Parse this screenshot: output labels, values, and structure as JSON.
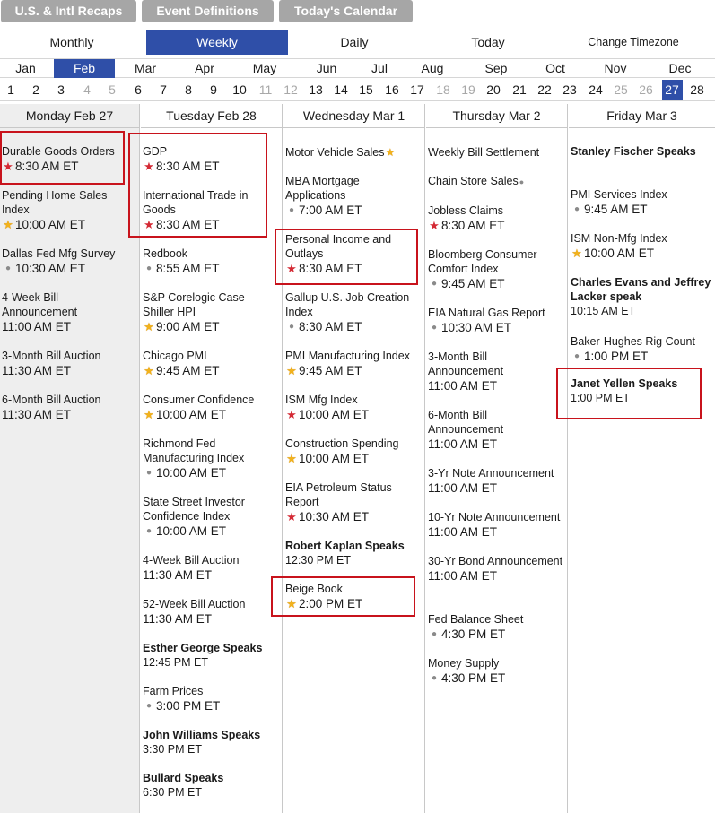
{
  "top_tabs": [
    "U.S. & Intl Recaps",
    "Event Definitions",
    "Today's Calendar"
  ],
  "views": [
    "Monthly",
    "Weekly",
    "Daily",
    "Today",
    "Change Timezone"
  ],
  "active_view": "Weekly",
  "months": [
    "Jan",
    "Feb",
    "Mar",
    "Apr",
    "May",
    "Jun",
    "Jul",
    "Aug",
    "Sep",
    "Oct",
    "Nov",
    "Dec"
  ],
  "active_month": "Feb",
  "days": [
    "1",
    "2",
    "3",
    "4",
    "5",
    "6",
    "7",
    "8",
    "9",
    "10",
    "11",
    "12",
    "13",
    "14",
    "15",
    "16",
    "17",
    "18",
    "19",
    "20",
    "21",
    "22",
    "23",
    "24",
    "25",
    "26",
    "27",
    "28"
  ],
  "muted_days": [
    "4",
    "5",
    "11",
    "12",
    "18",
    "19",
    "25",
    "26"
  ],
  "active_day": "27",
  "colors": {
    "accent": "#2f4fa8",
    "tab_gray": "#a6a6a6",
    "highlight_border": "#c8131c",
    "star_red": "#d42a35",
    "star_gold": "#f2b21c"
  },
  "icons": {
    "star-red": "★",
    "star-gold": "★",
    "dot": "●"
  },
  "columns": [
    {
      "header": "Monday Feb 27",
      "events": [
        {
          "title": "Durable Goods Orders",
          "marker": "star-red",
          "time": "8:30 AM ET"
        },
        {
          "title": "Pending Home Sales Index",
          "marker": "star-gold",
          "time": "10:00 AM ET"
        },
        {
          "title": "Dallas Fed Mfg Survey",
          "marker": "dot",
          "time": "10:30 AM ET"
        },
        {
          "title": "4-Week Bill Announcement",
          "marker": "",
          "time": "11:00 AM ET"
        },
        {
          "title": "3-Month Bill Auction",
          "marker": "",
          "time": "11:30 AM ET"
        },
        {
          "title": "6-Month Bill Auction",
          "marker": "",
          "time": "11:30 AM ET"
        }
      ]
    },
    {
      "header": "Tuesday Feb 28",
      "events": [
        {
          "title": "GDP",
          "marker": "star-red",
          "time": "8:30 AM ET"
        },
        {
          "title": "International Trade in Goods",
          "marker": "star-red",
          "time": "8:30 AM ET"
        },
        {
          "title": "Redbook",
          "marker": "dot",
          "time": "8:55 AM ET"
        },
        {
          "title": "S&P Corelogic Case-Shiller HPI",
          "marker": "star-gold",
          "time": "9:00 AM ET"
        },
        {
          "title": "Chicago PMI",
          "marker": "star-gold",
          "time": "9:45 AM ET"
        },
        {
          "title": "Consumer Confidence",
          "marker": "star-gold",
          "time": "10:00 AM ET"
        },
        {
          "title": "Richmond Fed Manufacturing Index",
          "marker": "dot",
          "time": "10:00 AM ET"
        },
        {
          "title": "State Street Investor Confidence Index",
          "marker": "dot",
          "time": "10:00 AM ET"
        },
        {
          "title": "4-Week Bill Auction",
          "marker": "",
          "time": "11:30 AM ET"
        },
        {
          "title": "52-Week Bill Auction",
          "marker": "",
          "time": "11:30 AM ET"
        },
        {
          "title": "Esther George Speaks",
          "bold": true,
          "marker": "",
          "time": "12:45 PM ET"
        },
        {
          "title": "Farm Prices",
          "marker": "dot",
          "time": "3:00 PM ET"
        },
        {
          "title": "John Williams Speaks",
          "bold": true,
          "marker": "",
          "time": "3:30 PM ET"
        },
        {
          "title": "Bullard Speaks",
          "bold": true,
          "marker": "",
          "time": "6:30 PM ET"
        }
      ]
    },
    {
      "header": "Wednesday Mar 1",
      "events": [
        {
          "title": "Motor Vehicle Sales",
          "inline": "star-gold",
          "marker": "",
          "time": ""
        },
        {
          "title": "MBA Mortgage Applications",
          "marker": "dot",
          "time": "7:00 AM ET"
        },
        {
          "title": "Personal Income and Outlays",
          "marker": "star-red",
          "time": "8:30 AM ET"
        },
        {
          "title": "Gallup U.S. Job Creation Index",
          "marker": "dot",
          "time": "8:30 AM ET"
        },
        {
          "title": "PMI Manufacturing Index",
          "marker": "star-gold",
          "time": "9:45 AM ET"
        },
        {
          "title": "ISM Mfg Index",
          "marker": "star-red",
          "time": "10:00 AM ET"
        },
        {
          "title": "Construction Spending",
          "marker": "star-gold",
          "time": "10:00 AM ET"
        },
        {
          "title": "EIA Petroleum Status Report",
          "marker": "star-red",
          "time": "10:30 AM ET"
        },
        {
          "title": "Robert Kaplan Speaks",
          "bold": true,
          "marker": "",
          "time": "12:30 PM ET"
        },
        {
          "title": "Beige Book",
          "marker": "star-gold",
          "time": "2:00 PM ET"
        }
      ]
    },
    {
      "header": "Thursday Mar 2",
      "events": [
        {
          "title": "Weekly Bill Settlement",
          "marker": "",
          "time": ""
        },
        {
          "title": "Chain Store Sales",
          "inline": "dot",
          "marker": "",
          "time": ""
        },
        {
          "title": "Jobless Claims",
          "marker": "star-red",
          "time": "8:30 AM ET"
        },
        {
          "title": "Bloomberg Consumer Comfort Index",
          "marker": "dot",
          "time": "9:45 AM ET"
        },
        {
          "title": "EIA Natural Gas Report",
          "marker": "dot",
          "time": "10:30 AM ET"
        },
        {
          "title": "3-Month Bill Announcement",
          "marker": "",
          "time": "11:00 AM ET"
        },
        {
          "title": "6-Month Bill Announcement",
          "marker": "",
          "time": "11:00 AM ET"
        },
        {
          "title": "3-Yr Note Announcement",
          "marker": "",
          "time": "11:00 AM ET"
        },
        {
          "title": "10-Yr Note Announcement",
          "marker": "",
          "time": "11:00 AM ET"
        },
        {
          "title": "30-Yr Bond Announcement",
          "marker": "",
          "time": "11:00 AM ET"
        },
        {
          "title": "Fed Balance Sheet",
          "marker": "dot",
          "time": "4:30 PM ET"
        },
        {
          "title": "Money Supply",
          "marker": "dot",
          "time": "4:30 PM ET"
        }
      ]
    },
    {
      "header": "Friday Mar 3",
      "events": [
        {
          "title": "Stanley Fischer Speaks",
          "bold": true,
          "marker": "",
          "time": ""
        },
        {
          "title": "PMI Services Index",
          "marker": "dot",
          "time": "9:45 AM ET"
        },
        {
          "title": "ISM Non-Mfg Index",
          "marker": "star-gold",
          "time": "10:00 AM ET"
        },
        {
          "title": "Charles Evans and Jeffrey Lacker speak",
          "bold": true,
          "marker": "",
          "time": "10:15 AM ET"
        },
        {
          "title": "Baker-Hughes Rig Count",
          "marker": "dot",
          "time": "1:00 PM ET"
        },
        {
          "title": "Janet Yellen Speaks",
          "bold": true,
          "marker": "",
          "time": "1:00 PM ET"
        }
      ]
    }
  ]
}
